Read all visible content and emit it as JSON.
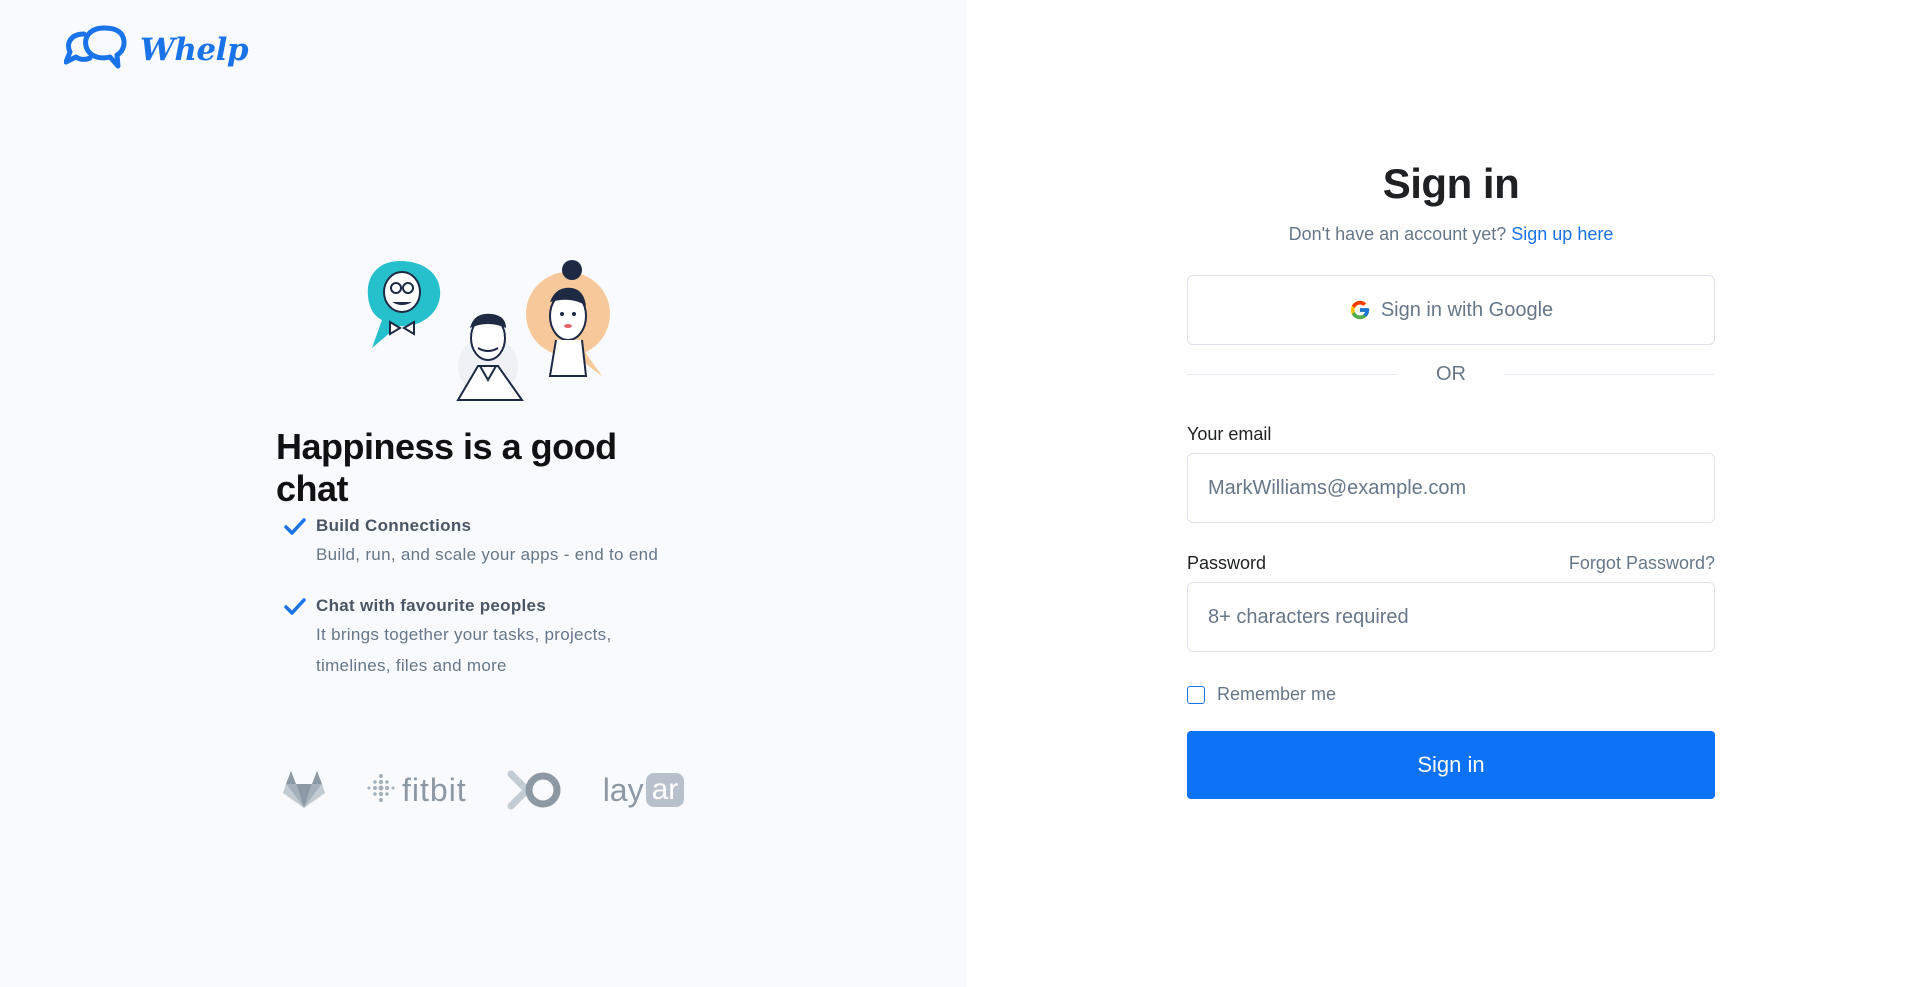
{
  "brand": {
    "name": "Whelp",
    "accent": "#1a73e8",
    "logo_icon": "chat-bubbles-icon"
  },
  "left": {
    "headline": "Happiness is a good chat",
    "features": [
      {
        "title": "Build Connections",
        "description": "Build, run, and scale your apps - end to end",
        "icon": "check-icon"
      },
      {
        "title": "Chat with favourite peoples",
        "description": "It brings together your tasks, projects, timelines, files and more",
        "icon": "check-icon"
      }
    ],
    "brands": [
      {
        "name": "gitlab",
        "icon": "gitlab-logo"
      },
      {
        "name": "fitbit",
        "label": "fitbit"
      },
      {
        "name": "xo",
        "icon": "xo-logo"
      },
      {
        "name": "layar",
        "label_prefix": "lay",
        "label_suffix": "ar"
      }
    ]
  },
  "form": {
    "title": "Sign in",
    "subtitle_text": "Don't have an account yet?",
    "signup_link": "Sign up here",
    "google_button": "Sign in with Google",
    "divider": "OR",
    "email_label": "Your email",
    "email_placeholder": "MarkWilliams@example.com",
    "password_label": "Password",
    "forgot_link": "Forgot Password?",
    "password_placeholder": "8+ characters required",
    "remember_label": "Remember me",
    "submit_button": "Sign in",
    "primary_color": "#0c72f7"
  }
}
